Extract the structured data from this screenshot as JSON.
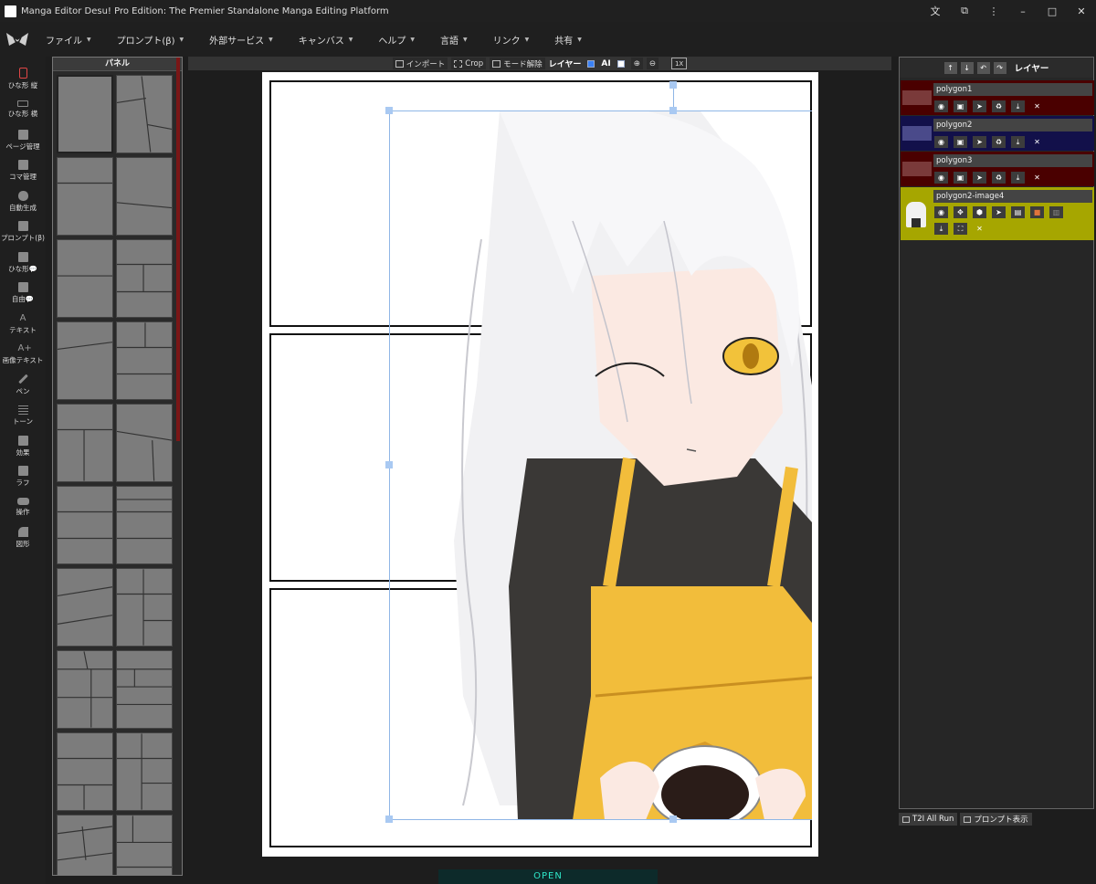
{
  "window": {
    "title": "Manga Editor Desu! Pro Edition: The Premier Standalone Manga Editing Platform",
    "controls": [
      "translate-icon",
      "extension-icon",
      "more-icon",
      "minimize-icon",
      "maximize-icon",
      "close-icon"
    ]
  },
  "menu": {
    "items": [
      {
        "label": "ファイル"
      },
      {
        "label": "プロンプト(β)"
      },
      {
        "label": "外部サービス"
      },
      {
        "label": "キャンバス"
      },
      {
        "label": "ヘルプ"
      },
      {
        "label": "言語"
      },
      {
        "label": "リンク"
      },
      {
        "label": "共有"
      }
    ]
  },
  "sidebar": {
    "items": [
      {
        "label": "ひな形 縦",
        "icon": "portrait-frame-icon"
      },
      {
        "label": "ひな形 横",
        "icon": "landscape-frame-icon"
      },
      {
        "label": "ページ管理",
        "icon": "page-grid-icon"
      },
      {
        "label": "コマ管理",
        "icon": "panel-grid-icon"
      },
      {
        "label": "自動生成",
        "icon": "robot-icon"
      },
      {
        "label": "プロンプト(β)",
        "icon": "clipboard-icon"
      },
      {
        "label": "ひな形💬",
        "icon": "speech-bubble-icon"
      },
      {
        "label": "自由💬",
        "icon": "free-bubble-icon"
      },
      {
        "label": "テキスト",
        "icon": "text-icon"
      },
      {
        "label": "画像テキスト",
        "icon": "image-text-icon"
      },
      {
        "label": "ペン",
        "icon": "pen-icon"
      },
      {
        "label": "トーン",
        "icon": "tone-icon"
      },
      {
        "label": "効果",
        "icon": "effect-icon"
      },
      {
        "label": "ラフ",
        "icon": "rough-icon"
      },
      {
        "label": "操作",
        "icon": "gamepad-icon"
      },
      {
        "label": "図形",
        "icon": "shapes-icon"
      }
    ]
  },
  "panel_library": {
    "title": "パネル",
    "thumb_count": 20
  },
  "toolbar": {
    "import_label": "インポート",
    "crop_label": "Crop",
    "mode_off_label": "モード解除",
    "layer_label": "レイヤー",
    "layer_checked": true,
    "ai_label": "AI",
    "ai_checked": false,
    "zoom_in": "zoom-in-icon",
    "zoom_out": "zoom-out-icon",
    "fit_label": "1X"
  },
  "canvas": {
    "frames": 3,
    "image_layer": "polygon2-image4"
  },
  "open_button": "OPEN",
  "layers": {
    "title": "レイヤー",
    "rows": [
      {
        "name": "polygon1",
        "color": "#4a0000",
        "swatch": "#7a3a3a"
      },
      {
        "name": "polygon2",
        "color": "#12104a",
        "swatch": "#4a4a8a"
      },
      {
        "name": "polygon3",
        "color": "#4a0000",
        "swatch": "#7a3a3a"
      },
      {
        "name": "polygon2-image4",
        "color": "#a6a600",
        "swatch": ""
      }
    ]
  },
  "bottom_buttons": {
    "run_all": "T2I All Run",
    "show_prompt": "プロンプト表示"
  }
}
